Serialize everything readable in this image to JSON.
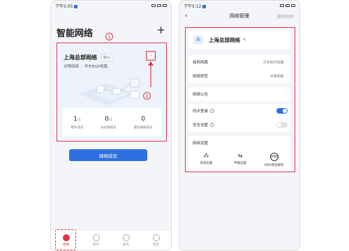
{
  "left": {
    "status": {
      "time": "下午5:05"
    },
    "title": "智能网络",
    "add_symbol": "+",
    "callout1": "1",
    "callout2": "2",
    "card": {
      "name": "上海总部网络",
      "tag": "默认",
      "type": "对等网络",
      "line": "华东BGP线路",
      "arrow": "›",
      "stats": [
        {
          "value": "1",
          "total": "/1",
          "label": "硬件成员"
        },
        {
          "value": "0",
          "total": "/2",
          "label": "访问端成员"
        },
        {
          "value": "0",
          "total": "",
          "label": "服务器端成员"
        }
      ]
    },
    "members_button": "网络成员",
    "tabs": [
      {
        "label": "组网",
        "active": true
      },
      {
        "label": "硬件",
        "active": false
      },
      {
        "label": "服务",
        "active": false
      },
      {
        "label": "我的",
        "active": false
      }
    ]
  },
  "right": {
    "status": {
      "time": "下午5:12"
    },
    "nav": {
      "back": "‹",
      "title": "网络管理",
      "delete": "删除网络"
    },
    "network_name": "上海总部网络",
    "rows1": [
      {
        "label": "组网线路",
        "value": "华东BGP线路"
      },
      {
        "label": "网络类型",
        "value": "对等网络"
      }
    ],
    "announcement": "网络公告",
    "sync_login": "同步登录",
    "security": "安全设置",
    "tools_title": "网络设置",
    "tools": [
      {
        "icon": "⁂",
        "label": "资源设置"
      },
      {
        "icon": "⇆",
        "label": "传输设置"
      },
      {
        "icon": "DNS",
        "label": "DNS域名解析"
      }
    ],
    "accent": "#2f6fe0",
    "highlight": "#e2354b"
  }
}
